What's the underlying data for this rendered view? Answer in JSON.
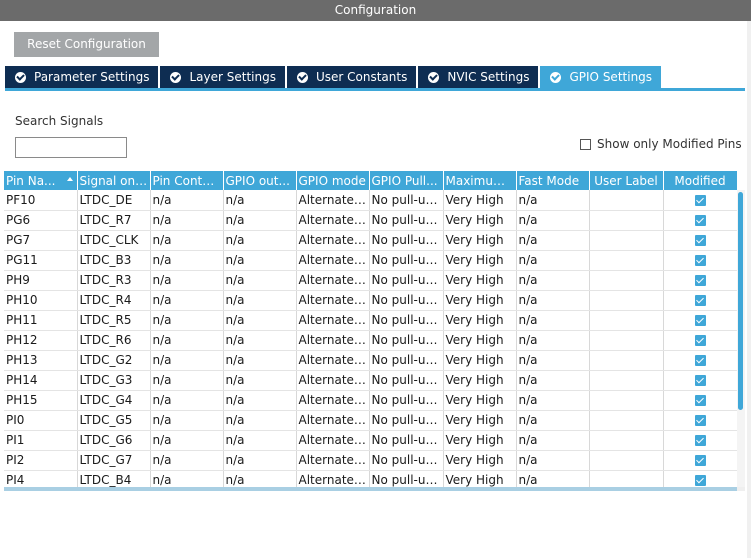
{
  "window": {
    "title": "Configuration"
  },
  "toolbar": {
    "reset_label": "Reset Configuration"
  },
  "tabs": [
    {
      "label": "Parameter Settings",
      "active": false
    },
    {
      "label": "Layer Settings",
      "active": false
    },
    {
      "label": "User Constants",
      "active": false
    },
    {
      "label": "NVIC Settings",
      "active": false
    },
    {
      "label": "GPIO Settings",
      "active": true
    }
  ],
  "search": {
    "label": "Search Signals",
    "value": "",
    "placeholder": ""
  },
  "filter": {
    "show_modified_label": "Show only Modified Pins",
    "checked": false
  },
  "colors": {
    "accent": "#3fa7d8",
    "tab_dark": "#0e2d52",
    "titlebar": "#6b6b6b",
    "button": "#a3a6a8"
  },
  "table": {
    "columns": [
      "Pin Na...",
      "Signal on ...",
      "Pin Conte...",
      "GPIO out...",
      "GPIO mode",
      "GPIO Pull...",
      "Maximum...",
      "Fast Mode",
      "User Label",
      "Modified"
    ],
    "rows": [
      {
        "pin": "PF10",
        "signal": "LTDC_DE",
        "context": "n/a",
        "output": "n/a",
        "mode": "Alternate ...",
        "pull": "No pull-up...",
        "speed": "Very High",
        "fast": "n/a",
        "label": "",
        "modified": true
      },
      {
        "pin": "PG6",
        "signal": "LTDC_R7",
        "context": "n/a",
        "output": "n/a",
        "mode": "Alternate ...",
        "pull": "No pull-up...",
        "speed": "Very High",
        "fast": "n/a",
        "label": "",
        "modified": true
      },
      {
        "pin": "PG7",
        "signal": "LTDC_CLK",
        "context": "n/a",
        "output": "n/a",
        "mode": "Alternate ...",
        "pull": "No pull-up...",
        "speed": "Very High",
        "fast": "n/a",
        "label": "",
        "modified": true
      },
      {
        "pin": "PG11",
        "signal": "LTDC_B3",
        "context": "n/a",
        "output": "n/a",
        "mode": "Alternate ...",
        "pull": "No pull-up...",
        "speed": "Very High",
        "fast": "n/a",
        "label": "",
        "modified": true
      },
      {
        "pin": "PH9",
        "signal": "LTDC_R3",
        "context": "n/a",
        "output": "n/a",
        "mode": "Alternate ...",
        "pull": "No pull-up...",
        "speed": "Very High",
        "fast": "n/a",
        "label": "",
        "modified": true
      },
      {
        "pin": "PH10",
        "signal": "LTDC_R4",
        "context": "n/a",
        "output": "n/a",
        "mode": "Alternate ...",
        "pull": "No pull-up...",
        "speed": "Very High",
        "fast": "n/a",
        "label": "",
        "modified": true
      },
      {
        "pin": "PH11",
        "signal": "LTDC_R5",
        "context": "n/a",
        "output": "n/a",
        "mode": "Alternate ...",
        "pull": "No pull-up...",
        "speed": "Very High",
        "fast": "n/a",
        "label": "",
        "modified": true
      },
      {
        "pin": "PH12",
        "signal": "LTDC_R6",
        "context": "n/a",
        "output": "n/a",
        "mode": "Alternate ...",
        "pull": "No pull-up...",
        "speed": "Very High",
        "fast": "n/a",
        "label": "",
        "modified": true
      },
      {
        "pin": "PH13",
        "signal": "LTDC_G2",
        "context": "n/a",
        "output": "n/a",
        "mode": "Alternate ...",
        "pull": "No pull-up...",
        "speed": "Very High",
        "fast": "n/a",
        "label": "",
        "modified": true
      },
      {
        "pin": "PH14",
        "signal": "LTDC_G3",
        "context": "n/a",
        "output": "n/a",
        "mode": "Alternate ...",
        "pull": "No pull-up...",
        "speed": "Very High",
        "fast": "n/a",
        "label": "",
        "modified": true
      },
      {
        "pin": "PH15",
        "signal": "LTDC_G4",
        "context": "n/a",
        "output": "n/a",
        "mode": "Alternate ...",
        "pull": "No pull-up...",
        "speed": "Very High",
        "fast": "n/a",
        "label": "",
        "modified": true
      },
      {
        "pin": "PI0",
        "signal": "LTDC_G5",
        "context": "n/a",
        "output": "n/a",
        "mode": "Alternate ...",
        "pull": "No pull-up...",
        "speed": "Very High",
        "fast": "n/a",
        "label": "",
        "modified": true
      },
      {
        "pin": "PI1",
        "signal": "LTDC_G6",
        "context": "n/a",
        "output": "n/a",
        "mode": "Alternate ...",
        "pull": "No pull-up...",
        "speed": "Very High",
        "fast": "n/a",
        "label": "",
        "modified": true
      },
      {
        "pin": "PI2",
        "signal": "LTDC_G7",
        "context": "n/a",
        "output": "n/a",
        "mode": "Alternate ...",
        "pull": "No pull-up...",
        "speed": "Very High",
        "fast": "n/a",
        "label": "",
        "modified": true
      },
      {
        "pin": "PI4",
        "signal": "LTDC_B4",
        "context": "n/a",
        "output": "n/a",
        "mode": "Alternate ...",
        "pull": "No pull-up...",
        "speed": "Very High",
        "fast": "n/a",
        "label": "",
        "modified": true
      }
    ]
  }
}
